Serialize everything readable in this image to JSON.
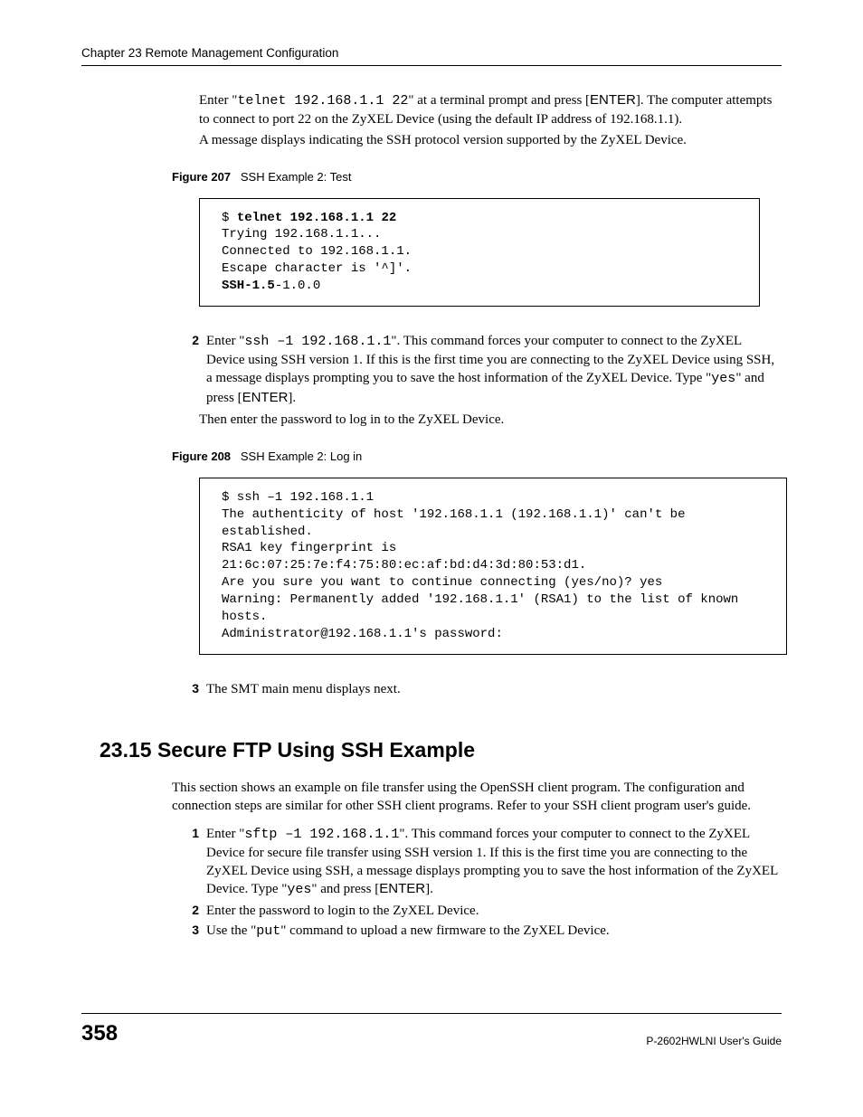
{
  "header": {
    "chapter": "Chapter 23 Remote Management Configuration"
  },
  "intro1": {
    "pre": "Enter \"",
    "cmd": "telnet 192.168.1.1 22",
    "post1": "\" at a terminal prompt and press [",
    "enter": "ENTER",
    "post2": "]. The computer attempts to connect to port 22 on the ZyXEL Device (using the default IP address of 192.168.1.1).",
    "line2": "A message displays indicating the SSH protocol version supported by the ZyXEL Device."
  },
  "figure207": {
    "label": "Figure 207",
    "caption": "SSH Example 2: Test",
    "code_prefix": "$ ",
    "code_bold1": "telnet 192.168.1.1 22",
    "code_body": "Trying 192.168.1.1...\nConnected to 192.168.1.1.\nEscape character is '^]'.",
    "code_bold2": "SSH-1.5",
    "code_tail": "-1.0.0"
  },
  "step2": {
    "num": "2",
    "pre": "Enter \"",
    "cmd": "ssh –1 192.168.1.1",
    "post1": "\". This command forces your computer to connect to the ZyXEL Device using SSH version 1. If this is the first time you are connecting to the ZyXEL Device using SSH, a message displays prompting you to save the host information of the ZyXEL Device. Type \"",
    "yes": "yes",
    "post2": "\" and press [",
    "enter": "ENTER",
    "post3": "].",
    "then": "Then enter the password to log in to the ZyXEL Device."
  },
  "figure208": {
    "label": "Figure 208",
    "caption": "SSH Example 2: Log in",
    "code": "$ ssh –1 192.168.1.1\nThe authenticity of host '192.168.1.1 (192.168.1.1)' can't be established.\nRSA1 key fingerprint is 21:6c:07:25:7e:f4:75:80:ec:af:bd:d4:3d:80:53:d1.\nAre you sure you want to continue connecting (yes/no)? yes\nWarning: Permanently added '192.168.1.1' (RSA1) to the list of known hosts.\nAdministrator@192.168.1.1's password:"
  },
  "step3": {
    "num": "3",
    "text": "The SMT main menu displays next."
  },
  "section": {
    "heading": "23.15  Secure FTP Using SSH Example",
    "intro": "This section shows an example on file transfer using the OpenSSH client program. The configuration and connection steps are similar for other SSH client programs. Refer to your SSH client program user's guide."
  },
  "secsteps": {
    "s1": {
      "num": "1",
      "pre": "Enter \"",
      "cmd": "sftp –1 192.168.1.1",
      "post1": "\". This command forces your computer to connect to the ZyXEL Device for secure file transfer using SSH version 1. If this is the first time you are connecting to the ZyXEL Device using SSH, a message displays prompting you to save the host information of the ZyXEL Device. Type \"",
      "yes": "yes",
      "post2": "\" and press [",
      "enter": "ENTER",
      "post3": "]."
    },
    "s2": {
      "num": "2",
      "text": "Enter the password to login to the ZyXEL Device."
    },
    "s3": {
      "num": "3",
      "pre": "Use the \"",
      "cmd": "put",
      "post": "\" command to upload a new firmware to the ZyXEL Device."
    }
  },
  "footer": {
    "page": "358",
    "guide": "P-2602HWLNI User's Guide"
  }
}
